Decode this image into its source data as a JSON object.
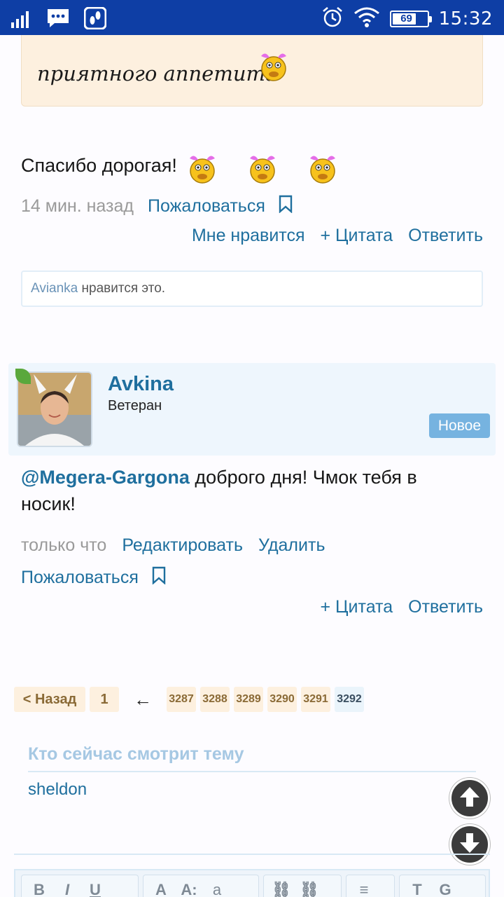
{
  "status_bar": {
    "time": "15:32",
    "battery_level": "69",
    "icons": [
      "signal-icon",
      "message-icon",
      "foot-app-icon",
      "alarm-icon",
      "wifi-icon",
      "battery-icon"
    ]
  },
  "quote": {
    "text": "приятного аппетита"
  },
  "post1": {
    "text": "Спасибо дорогая!",
    "time": "14 мин. назад",
    "report_label": "Пожаловаться",
    "like_label": "Мне нравится",
    "quote_label": "+ Цитата",
    "reply_label": "Ответить",
    "likes": {
      "user": "Avianka",
      "suffix": "нравится это."
    }
  },
  "post2": {
    "author": "Avkina",
    "rank": "Ветеран",
    "badge": "Новое",
    "mention": "@Megera-Gargona",
    "text": "доброго дня! Чмок тебя в носик!",
    "time": "только что",
    "edit_label": "Редактировать",
    "delete_label": "Удалить",
    "report_label": "Пожаловаться",
    "quote_label": "+ Цитата",
    "reply_label": "Ответить"
  },
  "pagination": {
    "back_label": "< Назад",
    "first_page": "1",
    "ellipsis_arrow": "←",
    "pages": [
      "3287",
      "3288",
      "3289",
      "3290",
      "3291"
    ],
    "current_page": "3292"
  },
  "viewers": {
    "title": "Кто сейчас смотрит тему",
    "names": [
      "sheldon"
    ]
  },
  "editor_toolbar": {
    "bold": "B",
    "italic": "I",
    "underline": "U",
    "font_color": "A",
    "font_size": "A:",
    "font_face": "a",
    "link": "⛓",
    "unlink": "⛓",
    "align": "≡",
    "clear_format": "T",
    "more": "G"
  },
  "colors": {
    "status_bar": "#0e3ea5",
    "link": "#1f6f9e",
    "quote_bg": "#fdf0df",
    "author_card_bg": "#eef6fd",
    "badge_new": "#76b3e0"
  }
}
